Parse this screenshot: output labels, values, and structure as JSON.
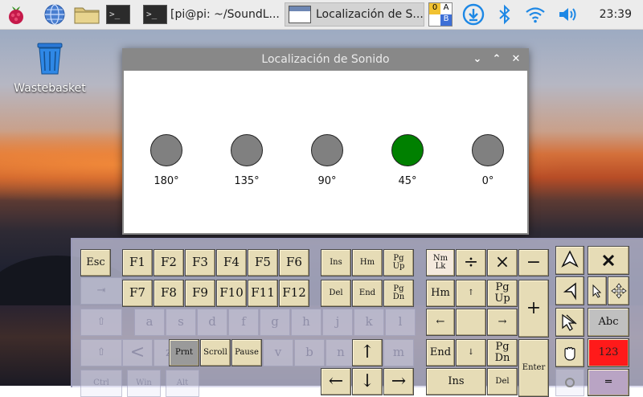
{
  "taskbar": {
    "terminal_short": ">_",
    "terminal_window_title": "[pi@pi: ~/SoundL...",
    "app_window_title": "Localización de S...",
    "keyboard_indicator": [
      "0",
      "A",
      "",
      "B"
    ],
    "clock": "23:39"
  },
  "desktop": {
    "wastebasket_label": "Wastebasket"
  },
  "dialog": {
    "title": "Localización de Sonido",
    "controls": [
      "⌄",
      "⌃",
      "✕"
    ],
    "mics": [
      {
        "label": "180°",
        "color": "#808080"
      },
      {
        "label": "135°",
        "color": "#808080"
      },
      {
        "label": "90°",
        "color": "#808080"
      },
      {
        "label": "45°",
        "color": "#008000"
      },
      {
        "label": "0°",
        "color": "#808080"
      }
    ]
  },
  "keyboard": {
    "keys": {
      "esc": "Esc",
      "f1": "F1",
      "f2": "F2",
      "f3": "F3",
      "f4": "F4",
      "f5": "F5",
      "f6": "F6",
      "f7": "F7",
      "f8": "F8",
      "f9": "F9",
      "f10": "F10",
      "f11": "F11",
      "f12": "F12",
      "ins": "Ins",
      "hm": "Hm",
      "pgup": "Pg\nUp",
      "del": "Del",
      "end": "End",
      "pgdn": "Pg\nDn",
      "prnt": "Prnt",
      "scroll": "Scroll",
      "pause": "Pause",
      "numlk": "Nm\nLk",
      "div": "÷",
      "mul": "×",
      "minus": "−",
      "np_hm": "Hm",
      "np_up": "↑",
      "np_pgup": "Pg\nUp",
      "plus": "+",
      "np_left": "←",
      "np_right": "→",
      "np_end": "End",
      "np_down": "↓",
      "np_pgdn": "Pg\nDn",
      "np_ins": "Ins",
      "np_del": "Del",
      "enter": "Enter",
      "arrow_up": "↑",
      "arrow_left": "←",
      "arrow_down": "↓",
      "arrow_right": "→",
      "abc": "Abc",
      "num123": "123",
      "eq": "═",
      "ghost_tab": "⇥",
      "ghost_caps": "⇧",
      "ghost_shift": "⇧",
      "ghost_a": "a",
      "ghost_s": "s",
      "ghost_d": "d",
      "ghost_f": "f",
      "ghost_g": "g",
      "ghost_h": "h",
      "ghost_j": "j",
      "ghost_k": "k",
      "ghost_l": "l",
      "ghost_lt": "<",
      "ghost_z": "z",
      "ghost_x": "x",
      "ghost_c": "c",
      "ghost_v": "v",
      "ghost_b": "b",
      "ghost_n": "n",
      "ghost_m": "m",
      "ghost_ctrl": "Ctrl",
      "ghost_win": "Win",
      "ghost_alt": "Alt"
    }
  }
}
